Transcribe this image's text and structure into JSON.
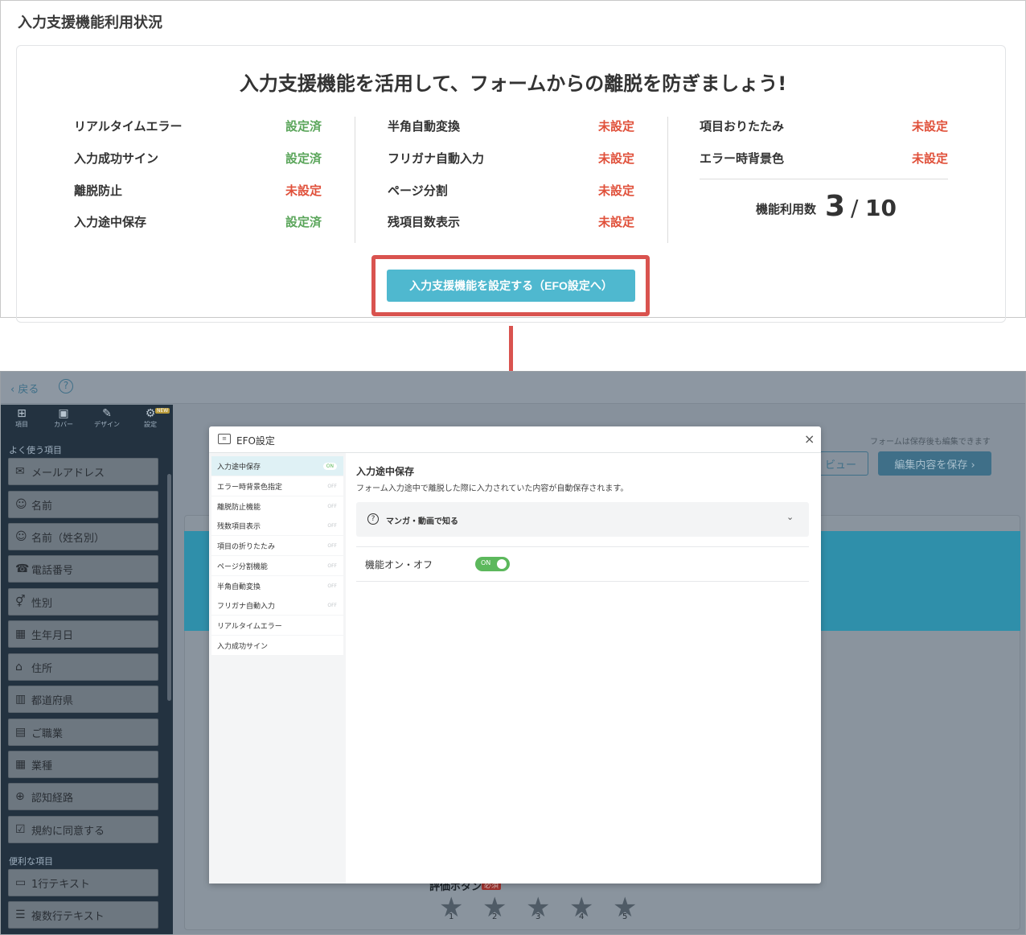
{
  "top": {
    "heading": "入力支援機能利用状況",
    "card_title": "入力支援機能を活用して、フォームからの離脱を防ぎましょう!",
    "columns": [
      [
        {
          "label": "リアルタイムエラー",
          "status": "設定済"
        },
        {
          "label": "入力成功サイン",
          "status": "設定済"
        },
        {
          "label": "離脱防止",
          "status": "未設定"
        },
        {
          "label": "入力途中保存",
          "status": "設定済"
        }
      ],
      [
        {
          "label": "半角自動変換",
          "status": "未設定"
        },
        {
          "label": "フリガナ自動入力",
          "status": "未設定"
        },
        {
          "label": "ページ分割",
          "status": "未設定"
        },
        {
          "label": "残項目数表示",
          "status": "未設定"
        }
      ],
      [
        {
          "label": "項目おりたたみ",
          "status": "未設定"
        },
        {
          "label": "エラー時背景色",
          "status": "未設定"
        }
      ]
    ],
    "count_label": "機能利用数",
    "count_value": "3",
    "count_sep": "/",
    "count_max": "10",
    "cta_label": "入力支援機能を設定する（EFO設定へ）",
    "colors": {
      "ok": "#5aa55a",
      "ng": "#e0503a",
      "accent": "#4fb8cf",
      "highlight": "#d9534f"
    }
  },
  "app": {
    "back_label": "戻る",
    "help_icon": "?",
    "tabs": [
      {
        "icon": "plus-square-icon",
        "glyph": "⊞",
        "label": "項目"
      },
      {
        "icon": "image-icon",
        "glyph": "▣",
        "label": "カバー"
      },
      {
        "icon": "wand-icon",
        "glyph": "✎",
        "label": "デザイン"
      },
      {
        "icon": "gear-icon",
        "glyph": "⚙",
        "label": "設定"
      }
    ],
    "new_badge": "NEW",
    "section_common": "よく使う項目",
    "common_items": [
      {
        "icon": "mail-icon",
        "glyph": "✉",
        "label": "メールアドレス"
      },
      {
        "icon": "person-icon",
        "glyph": "☺",
        "label": "名前"
      },
      {
        "icon": "person-icon",
        "glyph": "☺",
        "label": "名前（姓名別）"
      },
      {
        "icon": "phone-icon",
        "glyph": "☎",
        "label": "電話番号"
      },
      {
        "icon": "gender-icon",
        "glyph": "⚥",
        "label": "性別"
      },
      {
        "icon": "calendar-icon",
        "glyph": "▦",
        "label": "生年月日"
      },
      {
        "icon": "home-icon",
        "glyph": "⌂",
        "label": "住所"
      },
      {
        "icon": "map-icon",
        "glyph": "▥",
        "label": "都道府県"
      },
      {
        "icon": "badge-icon",
        "glyph": "▤",
        "label": "ご職業"
      },
      {
        "icon": "building-icon",
        "glyph": "▦",
        "label": "業種"
      },
      {
        "icon": "globe-icon",
        "glyph": "⊕",
        "label": "認知経路"
      },
      {
        "icon": "checkbox-icon",
        "glyph": "☑",
        "label": "規約に同意する"
      }
    ],
    "section_useful": "便利な項目",
    "useful_items": [
      {
        "icon": "textbox-icon",
        "glyph": "▭",
        "label": "1行テキスト"
      },
      {
        "icon": "textarea-icon",
        "glyph": "☰",
        "label": "複数行テキスト"
      }
    ],
    "save_note": "フォームは保存後も編集できます",
    "preview_label": "ビュー",
    "save_label": "編集内容を保存 ›",
    "rating_label": "評価ボタン",
    "required_label": "必須",
    "stars": [
      "1",
      "2",
      "3",
      "4",
      "5"
    ]
  },
  "modal": {
    "title": "EFO設定",
    "close": "×",
    "nav": [
      {
        "label": "入力途中保存",
        "state": "ON"
      },
      {
        "label": "エラー時背景色指定",
        "state": "OFF"
      },
      {
        "label": "離脱防止機能",
        "state": "OFF"
      },
      {
        "label": "残数項目表示",
        "state": "OFF"
      },
      {
        "label": "項目の折りたたみ",
        "state": "OFF"
      },
      {
        "label": "ページ分割機能",
        "state": "OFF"
      },
      {
        "label": "半角自動変換",
        "state": "OFF"
      },
      {
        "label": "フリガナ自動入力",
        "state": "OFF"
      },
      {
        "label": "リアルタイムエラー",
        "state": ""
      },
      {
        "label": "入力成功サイン",
        "state": ""
      }
    ],
    "section_title": "入力途中保存",
    "section_desc": "フォーム入力途中で離脱した際に入力されていた内容が自動保存されます。",
    "accordion_label": "マンガ・動画で知る",
    "row_label": "機能オン・オフ",
    "toggle_text": "ON"
  }
}
